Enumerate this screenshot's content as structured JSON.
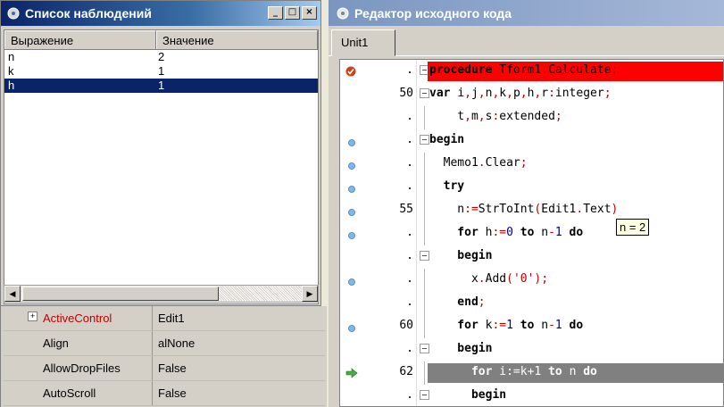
{
  "watch_window": {
    "title": "Список наблюдений",
    "window_buttons": [
      "_",
      "□",
      "×"
    ],
    "columns": [
      "Выражение",
      "Значение"
    ],
    "rows": [
      {
        "expr": "n",
        "value": "2"
      },
      {
        "expr": "k",
        "value": "1"
      },
      {
        "expr": "h",
        "value": "1",
        "selected": true
      }
    ],
    "scroll_left": "◀",
    "scroll_right": "▶"
  },
  "inspector": {
    "properties": [
      {
        "name": "ActiveControl",
        "value": "Edit1",
        "expandable": true
      },
      {
        "name": "Align",
        "value": "alNone"
      },
      {
        "name": "AllowDropFiles",
        "value": "False"
      },
      {
        "name": "AutoScroll",
        "value": "False"
      }
    ]
  },
  "editor": {
    "title": "Редактор исходного кода",
    "tab": "Unit1",
    "hint": "n = 2",
    "lines": [
      {
        "num": ".",
        "mark": "breakpoint",
        "fold": "box",
        "highlight": "red",
        "tokens": [
          [
            "kw",
            "procedure "
          ],
          [
            "",
            "Tform1"
          ],
          [
            "sym",
            "."
          ],
          [
            "",
            "Calculate"
          ],
          [
            "sym",
            ";"
          ]
        ]
      },
      {
        "num": "50",
        "fold": "box",
        "tokens": [
          [
            "kw",
            "var "
          ],
          [
            "",
            "i"
          ],
          [
            "sym",
            ","
          ],
          [
            "",
            "j"
          ],
          [
            "sym",
            ","
          ],
          [
            "",
            "n"
          ],
          [
            "sym",
            ","
          ],
          [
            "",
            "k"
          ],
          [
            "sym",
            ","
          ],
          [
            "",
            "p"
          ],
          [
            "sym",
            ","
          ],
          [
            "",
            "h"
          ],
          [
            "sym",
            ","
          ],
          [
            "",
            "r"
          ],
          [
            "sym",
            ":"
          ],
          [
            "",
            "integer"
          ],
          [
            "sym",
            ";"
          ]
        ]
      },
      {
        "num": ".",
        "fold": "line",
        "tokens": [
          [
            "",
            "    t"
          ],
          [
            "sym",
            ","
          ],
          [
            "",
            "m"
          ],
          [
            "sym",
            ","
          ],
          [
            "",
            "s"
          ],
          [
            "sym",
            ":"
          ],
          [
            "",
            "extended"
          ],
          [
            "sym",
            ";"
          ]
        ]
      },
      {
        "num": ".",
        "mark": "dot",
        "fold": "box",
        "tokens": [
          [
            "kw",
            "begin"
          ]
        ]
      },
      {
        "num": ".",
        "mark": "dot",
        "fold": "line",
        "tokens": [
          [
            "",
            "  Memo1"
          ],
          [
            "sym",
            "."
          ],
          [
            "",
            "Clear"
          ],
          [
            "sym",
            ";"
          ]
        ]
      },
      {
        "num": ".",
        "mark": "dot",
        "fold": "line",
        "tokens": [
          [
            "kw",
            "  try"
          ]
        ]
      },
      {
        "num": "55",
        "mark": "dot",
        "fold": "line",
        "tokens": [
          [
            "",
            "    n"
          ],
          [
            "sym",
            ":="
          ],
          [
            "",
            "StrToInt"
          ],
          [
            "sym",
            "("
          ],
          [
            "",
            "Edit1"
          ],
          [
            "sym",
            "."
          ],
          [
            "",
            "Text"
          ],
          [
            "sym",
            ")"
          ]
        ]
      },
      {
        "num": ".",
        "mark": "dot",
        "fold": "line",
        "tokens": [
          [
            "kw",
            "    for "
          ],
          [
            "",
            "h"
          ],
          [
            "sym",
            ":="
          ],
          [
            "num",
            "0"
          ],
          [
            "kw",
            " to "
          ],
          [
            "",
            "n"
          ],
          [
            "sym",
            "-"
          ],
          [
            "num",
            "1"
          ],
          [
            "kw",
            " do"
          ]
        ]
      },
      {
        "num": ".",
        "fold": "box",
        "tokens": [
          [
            "kw",
            "    begin"
          ]
        ]
      },
      {
        "num": ".",
        "mark": "dot",
        "fold": "line",
        "tokens": [
          [
            "",
            "      x"
          ],
          [
            "sym",
            "."
          ],
          [
            "",
            "Add"
          ],
          [
            "sym",
            "("
          ],
          [
            "str",
            "'0'"
          ],
          [
            "sym",
            ");"
          ]
        ]
      },
      {
        "num": ".",
        "fold": "line",
        "tokens": [
          [
            "kw",
            "    end"
          ],
          [
            "sym",
            ";"
          ]
        ]
      },
      {
        "num": "60",
        "mark": "dot",
        "fold": "line",
        "tokens": [
          [
            "kw",
            "    for "
          ],
          [
            "",
            "k"
          ],
          [
            "sym",
            ":="
          ],
          [
            "num",
            "1"
          ],
          [
            "kw",
            " to "
          ],
          [
            "",
            "n"
          ],
          [
            "sym",
            "-"
          ],
          [
            "num",
            "1"
          ],
          [
            "kw",
            " do"
          ]
        ]
      },
      {
        "num": ".",
        "fold": "box",
        "tokens": [
          [
            "kw",
            "    begin"
          ]
        ]
      },
      {
        "num": "62",
        "mark": "arrow",
        "fold": "line",
        "highlight": "grey",
        "tokens": [
          [
            "kw",
            "      for "
          ],
          [
            "",
            "i"
          ],
          [
            "",
            ":="
          ],
          [
            "",
            "k"
          ],
          [
            "",
            "+"
          ],
          [
            "",
            "1"
          ],
          [
            "kw",
            " to "
          ],
          [
            "",
            "n"
          ],
          [
            "kw",
            " do"
          ]
        ]
      },
      {
        "num": ".",
        "fold": "box",
        "tokens": [
          [
            "kw",
            "      begin"
          ]
        ]
      }
    ]
  }
}
